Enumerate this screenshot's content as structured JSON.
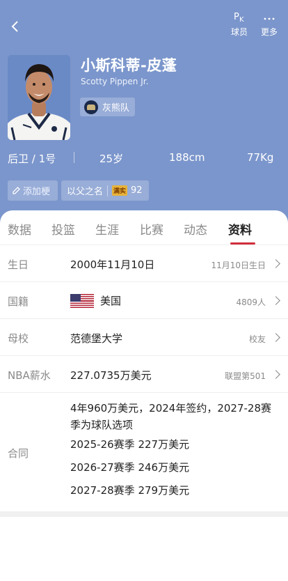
{
  "header": {
    "pk_icon_letters": [
      "P",
      "K"
    ],
    "actions": [
      {
        "label": "球员",
        "icon": "pk-icon"
      },
      {
        "label": "更多",
        "icon": "more-dots-icon"
      }
    ],
    "bg_color": "#7b96cc"
  },
  "player": {
    "name_cn": "小斯科蒂-皮蓬",
    "name_en": "Scotty Pippen Jr.",
    "team": "灰熊队",
    "position_number": "后卫 / 1号",
    "age": "25岁",
    "height": "188cm",
    "weight": "77Kg"
  },
  "tags": {
    "add_label": "添加梗",
    "nickname": "以父之名",
    "fire_badge": "满实",
    "fire_count": "92"
  },
  "tabs": [
    "数据",
    "投篮",
    "生涯",
    "比赛",
    "动态",
    "资料"
  ],
  "active_tab": "资料",
  "accent_color": "#d12d3b",
  "profile": {
    "birthday": {
      "label": "生日",
      "value": "2000年11月10日",
      "extra": "11月10日生日"
    },
    "nationality": {
      "label": "国籍",
      "value": "美国",
      "extra": "4809人"
    },
    "school": {
      "label": "母校",
      "value": "范德堡大学",
      "extra": "校友"
    },
    "salary": {
      "label": "NBA薪水",
      "value": "227.0735万美元",
      "extra": "联盟第501"
    },
    "contract": {
      "label": "合同",
      "lines": [
        "4年960万美元，2024年签约，2027-28赛季为球队选项",
        "2025-26赛季 227万美元",
        "2026-27赛季 246万美元",
        "2027-28赛季 279万美元"
      ]
    }
  }
}
